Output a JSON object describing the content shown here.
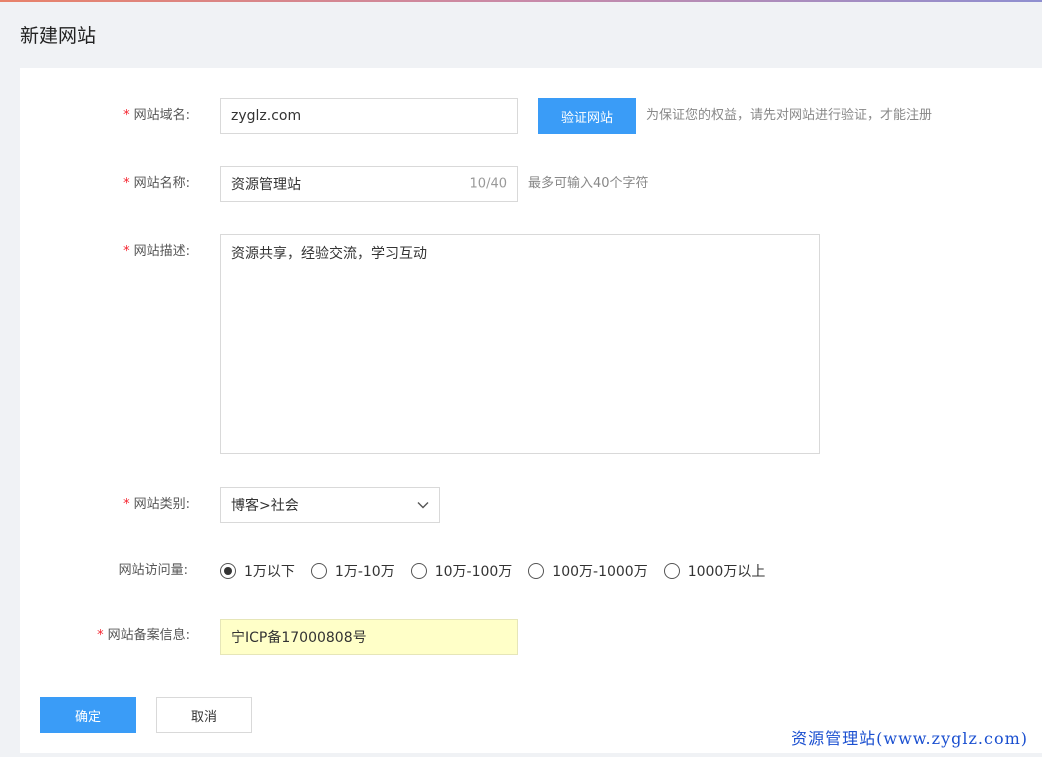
{
  "page": {
    "title": "新建网站"
  },
  "form": {
    "domain": {
      "label": "网站域名:",
      "required_mark": "*",
      "value": "zyglz.com",
      "verify_button": "验证网站",
      "hint": "为保证您的权益，请先对网站进行验证，才能注册"
    },
    "name": {
      "label": "网站名称:",
      "required_mark": "*",
      "value": "资源管理站",
      "counter": "10/40",
      "hint": "最多可输入40个字符"
    },
    "description": {
      "label": "网站描述:",
      "required_mark": "*",
      "value": "资源共享，经验交流，学习互动"
    },
    "category": {
      "label": "网站类别:",
      "required_mark": "*",
      "value": "博客>社会"
    },
    "traffic": {
      "label": "网站访问量:",
      "options": [
        "1万以下",
        "1万-10万",
        "10万-100万",
        "100万-1000万",
        "1000万以上"
      ],
      "selected_index": 0
    },
    "icp": {
      "label": "网站备案信息:",
      "required_mark": "*",
      "value": "宁ICP备17000808号",
      "highlight_color": "#ffffc8"
    }
  },
  "actions": {
    "confirm": "确定",
    "cancel": "取消"
  },
  "watermark": "资源管理站(www.zyglz.com)",
  "colors": {
    "primary": "#3a9cf7",
    "required": "#f5222d"
  }
}
